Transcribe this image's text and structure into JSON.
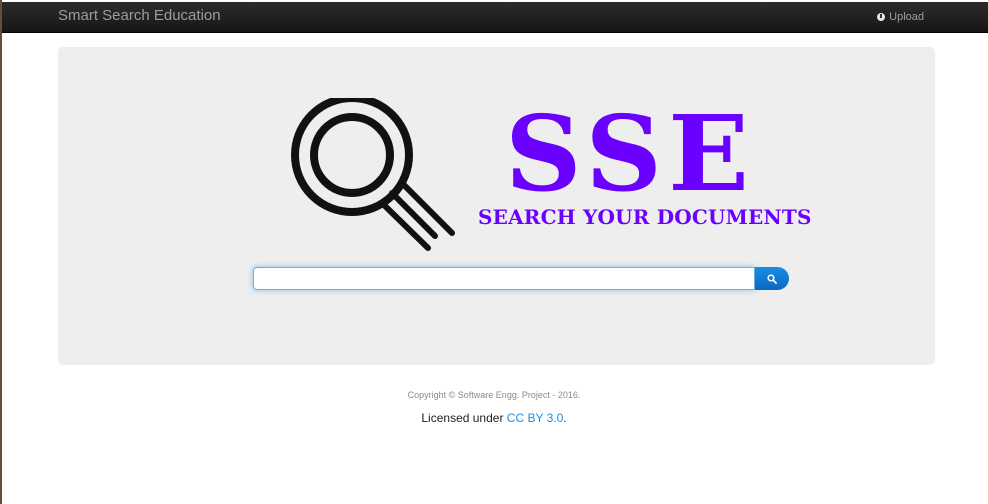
{
  "navbar": {
    "brand": "Smart Search Education",
    "upload_label": "Upload",
    "upload_icon": "upload-icon"
  },
  "logo": {
    "title": "SSE",
    "subtitle": "SEARCH YOUR DOCUMENTS",
    "icon": "magnifier-icon",
    "color": "#6a00ff"
  },
  "search": {
    "value": "",
    "placeholder": "",
    "button_icon": "search-icon",
    "button_color": "#1b8ee4"
  },
  "footer": {
    "copyright": "Copyright © Software Engg. Project - 2016.",
    "license_prefix": "Licensed under ",
    "license_link": "CC BY 3.0",
    "license_suffix": "."
  }
}
